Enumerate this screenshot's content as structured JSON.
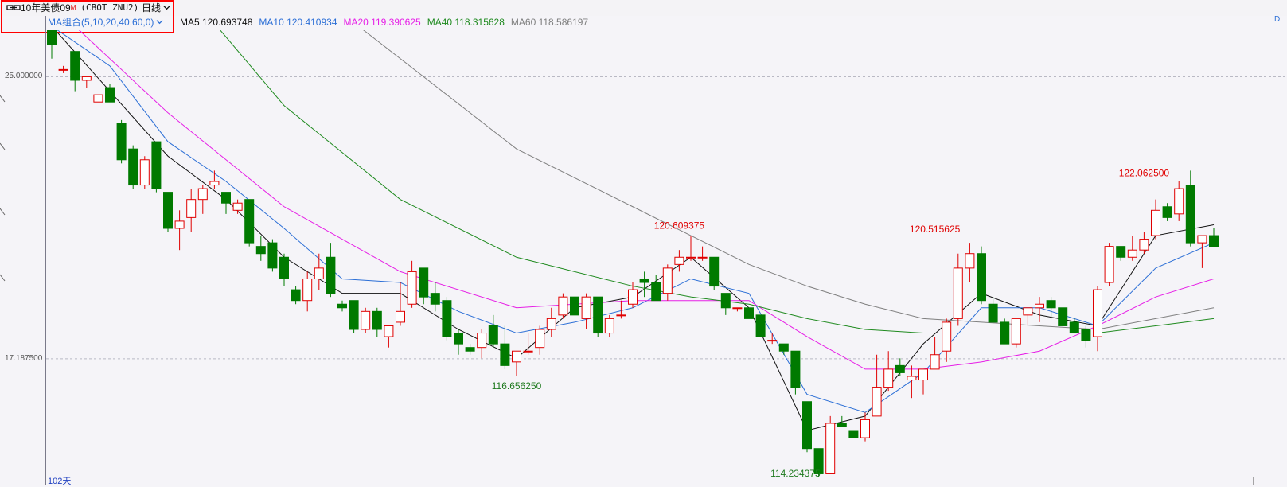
{
  "toolbar": {
    "symbol": {
      "name": "10年美债09",
      "mark": "M",
      "code": "(CBOT ZNU2)"
    },
    "period": "日线",
    "ma_group": "MA组合(5,10,20,40,60,0)"
  },
  "legend": [
    {
      "label": "MA5 120.693748",
      "color": "#111111"
    },
    {
      "label": "MA10 120.410934",
      "color": "#2c6fd6"
    },
    {
      "label": "MA20 119.390625",
      "color": "#e61ee6"
    },
    {
      "label": "MA40 118.315628",
      "color": "#1f8a1f"
    },
    {
      "label": "MA60 118.586197",
      "color": "#7f7f7f"
    }
  ],
  "axis": {
    "ticks": [
      {
        "label": "25.000000",
        "value": 125.0
      },
      {
        "label": "17.187500",
        "value": 117.1875
      }
    ]
  },
  "period_count": "102天",
  "right_edge_label": "D",
  "annotations": [
    {
      "text": "116.656250",
      "idx": 40,
      "value": 116.65625,
      "color": "#1f7a1f",
      "pos": "below"
    },
    {
      "text": "120.609375",
      "idx": 54,
      "value": 120.609375,
      "color": "#e00000",
      "pos": "above"
    },
    {
      "text": "114.234375",
      "idx": 64,
      "value": 114.234375,
      "color": "#1f7a1f",
      "pos": "below"
    },
    {
      "text": "120.515625",
      "idx": 76,
      "value": 120.515625,
      "color": "#e00000",
      "pos": "above"
    },
    {
      "text": "122.062500",
      "idx": 94,
      "value": 122.0625,
      "color": "#e00000",
      "pos": "above"
    }
  ],
  "chart_data": {
    "type": "candlestick",
    "ylim": [
      113.9,
      126.2
    ],
    "up_color": "#e00000",
    "down_color": "#007a00",
    "candles": [
      [
        126.3,
        126.7,
        125.5,
        125.9
      ],
      [
        125.2,
        125.3,
        125.1,
        125.2
      ],
      [
        125.7,
        125.7,
        124.6,
        124.9
      ],
      [
        124.9,
        125.0,
        124.7,
        125.0
      ],
      [
        124.3,
        124.5,
        124.3,
        124.5
      ],
      [
        124.7,
        124.8,
        124.3,
        124.3
      ],
      [
        123.7,
        123.8,
        122.6,
        122.7
      ],
      [
        123.0,
        123.1,
        121.9,
        122.0
      ],
      [
        122.0,
        122.8,
        121.9,
        122.7
      ],
      [
        123.2,
        123.2,
        121.8,
        121.9
      ],
      [
        121.8,
        121.8,
        120.7,
        120.8
      ],
      [
        120.8,
        121.3,
        120.2,
        121.0
      ],
      [
        121.1,
        121.9,
        120.7,
        121.6
      ],
      [
        121.6,
        122.0,
        121.2,
        121.9
      ],
      [
        122.0,
        122.4,
        121.9,
        122.1
      ],
      [
        121.8,
        121.8,
        121.2,
        121.5
      ],
      [
        121.3,
        121.6,
        121.2,
        121.5
      ],
      [
        121.6,
        121.6,
        120.3,
        120.4
      ],
      [
        120.3,
        120.6,
        119.9,
        120.1
      ],
      [
        120.4,
        120.5,
        119.6,
        119.7
      ],
      [
        120.0,
        120.1,
        119.2,
        119.4
      ],
      [
        119.1,
        119.2,
        118.7,
        118.8
      ],
      [
        118.8,
        119.6,
        118.5,
        119.4
      ],
      [
        119.4,
        120.1,
        119.1,
        119.7
      ],
      [
        120.0,
        120.4,
        118.9,
        119.0
      ],
      [
        118.7,
        118.8,
        118.5,
        118.6
      ],
      [
        118.8,
        118.8,
        117.9,
        118.0
      ],
      [
        118.0,
        118.6,
        117.9,
        118.5
      ],
      [
        118.5,
        118.6,
        117.8,
        118.0
      ],
      [
        117.8,
        118.1,
        117.5,
        118.1
      ],
      [
        118.2,
        119.3,
        118.1,
        118.5
      ],
      [
        118.7,
        119.9,
        118.6,
        119.6
      ],
      [
        119.7,
        119.7,
        118.7,
        118.9
      ],
      [
        119.0,
        119.3,
        118.5,
        118.7
      ],
      [
        118.8,
        118.9,
        117.7,
        117.8
      ],
      [
        117.9,
        118.0,
        117.3,
        117.6
      ],
      [
        117.5,
        117.6,
        117.3,
        117.4
      ],
      [
        117.5,
        118.0,
        117.2,
        117.9
      ],
      [
        118.1,
        118.4,
        117.5,
        117.6
      ],
      [
        117.6,
        118.1,
        116.9,
        117.0
      ],
      [
        117.1,
        117.4,
        116.7,
        117.4
      ],
      [
        117.4,
        117.9,
        117.3,
        117.4
      ],
      [
        117.5,
        118.1,
        117.3,
        118.0
      ],
      [
        118.0,
        118.6,
        117.8,
        118.3
      ],
      [
        118.4,
        119.0,
        118.3,
        118.9
      ],
      [
        118.9,
        118.9,
        118.4,
        118.4
      ],
      [
        118.3,
        119.0,
        118.0,
        118.9
      ],
      [
        118.9,
        118.9,
        117.8,
        117.9
      ],
      [
        117.9,
        118.4,
        117.8,
        118.3
      ],
      [
        118.4,
        118.8,
        118.3,
        118.4
      ],
      [
        118.7,
        119.3,
        118.6,
        119.1
      ],
      [
        119.4,
        119.6,
        118.9,
        119.3
      ],
      [
        119.3,
        119.5,
        118.8,
        118.8
      ],
      [
        119.0,
        119.8,
        118.8,
        119.7
      ],
      [
        119.8,
        120.2,
        119.6,
        120.0
      ],
      [
        120.0,
        120.6,
        119.9,
        120.0
      ],
      [
        120.0,
        120.3,
        119.9,
        120.0
      ],
      [
        120.0,
        120.0,
        119.1,
        119.2
      ],
      [
        119.0,
        119.0,
        118.4,
        118.6
      ],
      [
        118.6,
        118.6,
        118.5,
        118.6
      ],
      [
        118.6,
        118.6,
        118.3,
        118.3
      ],
      [
        118.4,
        118.4,
        117.8,
        117.8
      ],
      [
        117.7,
        117.9,
        117.6,
        117.7
      ],
      [
        117.6,
        117.6,
        117.3,
        117.4
      ],
      [
        117.4,
        117.4,
        116.2,
        116.4
      ],
      [
        116.0,
        116.0,
        114.6,
        114.7
      ],
      [
        114.7,
        114.7,
        113.9,
        114.0
      ],
      [
        114.0,
        115.6,
        114.0,
        115.4
      ],
      [
        115.4,
        115.6,
        115.3,
        115.3
      ],
      [
        115.2,
        115.2,
        115.0,
        115.0
      ],
      [
        115.0,
        115.7,
        114.9,
        115.5
      ],
      [
        115.6,
        117.3,
        115.6,
        116.4
      ],
      [
        116.4,
        117.4,
        116.3,
        116.9
      ],
      [
        117.0,
        117.2,
        116.7,
        116.8
      ],
      [
        116.6,
        117.0,
        116.1,
        116.7
      ],
      [
        116.6,
        116.9,
        116.2,
        116.9
      ],
      [
        116.9,
        117.8,
        116.9,
        117.3
      ],
      [
        117.4,
        118.3,
        117.1,
        118.2
      ],
      [
        118.3,
        120.1,
        118.1,
        119.7
      ],
      [
        119.7,
        120.4,
        119.3,
        120.1
      ],
      [
        120.1,
        120.3,
        118.7,
        118.8
      ],
      [
        118.7,
        118.9,
        118.2,
        118.2
      ],
      [
        118.2,
        118.3,
        117.6,
        117.6
      ],
      [
        117.6,
        118.2,
        117.5,
        118.3
      ],
      [
        118.4,
        118.6,
        118.1,
        118.6
      ],
      [
        118.6,
        118.9,
        118.2,
        118.7
      ],
      [
        118.8,
        118.9,
        118.3,
        118.6
      ],
      [
        118.6,
        118.6,
        118.1,
        118.1
      ],
      [
        118.2,
        118.3,
        117.9,
        117.9
      ],
      [
        118.0,
        118.1,
        117.5,
        117.7
      ],
      [
        117.8,
        119.2,
        117.4,
        119.1
      ],
      [
        119.3,
        120.4,
        119.2,
        120.3
      ],
      [
        120.3,
        120.3,
        119.9,
        120.0
      ],
      [
        120.0,
        120.6,
        119.9,
        120.2
      ],
      [
        120.2,
        120.7,
        120.1,
        120.5
      ],
      [
        120.6,
        121.6,
        120.5,
        121.3
      ],
      [
        121.4,
        121.5,
        121.0,
        121.1
      ],
      [
        121.2,
        122.1,
        121.0,
        121.9
      ],
      [
        122.0,
        122.4,
        120.3,
        120.4
      ],
      [
        120.4,
        120.6,
        119.7,
        120.6
      ],
      [
        120.6,
        120.8,
        120.3,
        120.3
      ]
    ],
    "ma": [
      {
        "name": "MA5",
        "color": "#111111",
        "x": [
          0,
          5,
          10,
          15,
          20,
          25,
          30,
          35,
          40,
          45,
          50,
          55,
          60,
          65,
          70,
          75,
          80,
          85,
          90,
          95,
          100
        ],
        "y": [
          126.4,
          124.6,
          122.8,
          121.6,
          120.0,
          119.0,
          119.0,
          118.0,
          117.2,
          118.6,
          118.9,
          120.0,
          118.6,
          115.2,
          115.6,
          117.6,
          119.0,
          118.4,
          118.1,
          120.6,
          120.9
        ]
      },
      {
        "name": "MA10",
        "color": "#2c6fd6",
        "x": [
          0,
          5,
          10,
          15,
          20,
          25,
          30,
          35,
          40,
          45,
          50,
          55,
          60,
          65,
          70,
          75,
          80,
          85,
          90,
          95,
          100
        ],
        "y": [
          126.4,
          125.3,
          123.2,
          122.1,
          120.8,
          119.4,
          119.3,
          118.5,
          117.9,
          118.2,
          118.6,
          119.4,
          119.0,
          116.2,
          115.7,
          116.8,
          118.6,
          118.6,
          118.1,
          119.7,
          120.4
        ]
      },
      {
        "name": "MA20",
        "color": "#e61ee6",
        "x": [
          0,
          10,
          20,
          30,
          40,
          50,
          60,
          65,
          70,
          75,
          80,
          85,
          90,
          95,
          100
        ],
        "y": [
          127.0,
          124.0,
          121.4,
          119.6,
          118.6,
          118.8,
          118.8,
          117.8,
          116.9,
          116.9,
          117.1,
          117.4,
          118.1,
          118.9,
          119.4
        ]
      },
      {
        "name": "MA40",
        "color": "#1f8a1f",
        "x": [
          0,
          10,
          20,
          30,
          40,
          50,
          55,
          60,
          65,
          70,
          75,
          80,
          85,
          90,
          95,
          100
        ],
        "y": [
          131.0,
          128.0,
          124.2,
          121.6,
          120.0,
          119.2,
          118.9,
          118.7,
          118.3,
          118.0,
          117.9,
          117.9,
          117.9,
          117.9,
          118.1,
          118.3
        ]
      },
      {
        "name": "MA60",
        "color": "#7f7f7f",
        "x": [
          0,
          10,
          20,
          30,
          40,
          50,
          55,
          60,
          65,
          70,
          75,
          80,
          85,
          90,
          95,
          100
        ],
        "y": [
          134.0,
          131.0,
          128.0,
          125.5,
          123.0,
          121.4,
          120.6,
          119.8,
          119.2,
          118.7,
          118.3,
          118.2,
          118.1,
          118.0,
          118.3,
          118.6
        ]
      }
    ]
  }
}
